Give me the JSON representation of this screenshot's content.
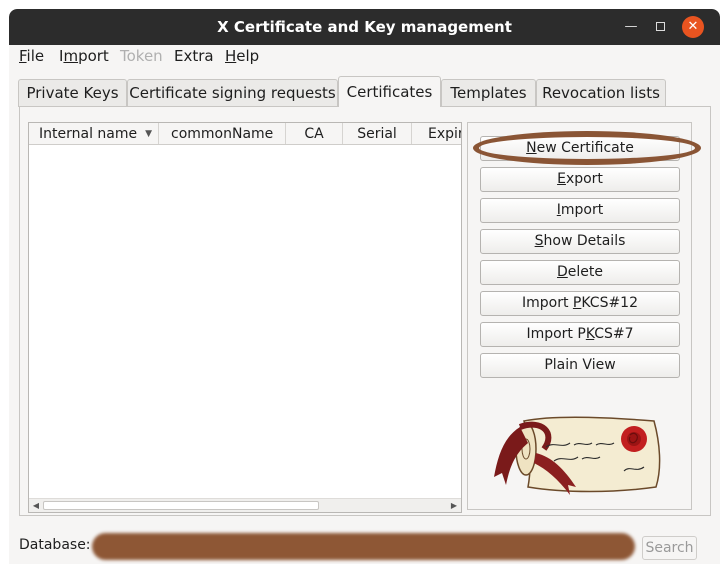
{
  "window": {
    "title": "X Certificate and Key management"
  },
  "menubar": {
    "items": [
      {
        "label": "File",
        "mnemonic": "F",
        "rest": "ile",
        "disabled": false
      },
      {
        "label": "Import",
        "mnemonic": "m",
        "pre": "I",
        "rest": "port",
        "disabled": false
      },
      {
        "label": "Token",
        "disabled": true
      },
      {
        "label": "Extra",
        "disabled": false
      },
      {
        "label": "Help",
        "mnemonic": "H",
        "rest": "elp",
        "disabled": false
      }
    ]
  },
  "tabs": [
    {
      "label": "Private Keys",
      "active": false
    },
    {
      "label": "Certificate signing requests",
      "active": false
    },
    {
      "label": "Certificates",
      "active": true
    },
    {
      "label": "Templates",
      "active": false
    },
    {
      "label": "Revocation lists",
      "active": false
    }
  ],
  "table": {
    "columns": [
      "Internal name",
      "commonName",
      "CA",
      "Serial",
      "Expiry"
    ],
    "rows": []
  },
  "buttons": {
    "new_certificate": {
      "pre": "",
      "mn": "N",
      "post": "ew Certificate"
    },
    "export": {
      "pre": "",
      "mn": "E",
      "post": "xport"
    },
    "import": {
      "pre": "",
      "mn": "I",
      "post": "mport"
    },
    "show_details": {
      "pre": "",
      "mn": "S",
      "post": "how Details"
    },
    "delete": {
      "pre": "",
      "mn": "D",
      "post": "elete"
    },
    "import_pkcs12": {
      "pre": "Import ",
      "mn": "P",
      "post": "KCS#12"
    },
    "import_pkcs7": {
      "pre": "Import P",
      "mn": "K",
      "post": "CS#7"
    },
    "plain_view": {
      "label": "Plain View"
    }
  },
  "status": {
    "database_label": "Database:",
    "search_label": "Search"
  },
  "colors": {
    "close_button": "#e95420",
    "annotation": "#8a5535",
    "redaction": "#8e5735"
  }
}
